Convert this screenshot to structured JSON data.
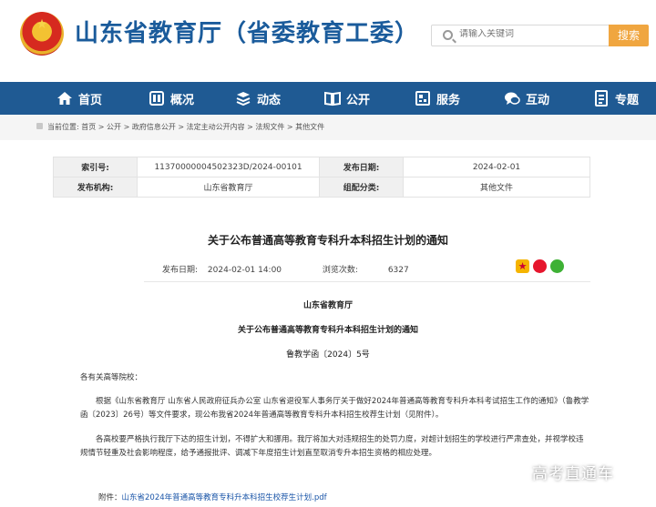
{
  "header": {
    "site_title": "山东省教育厅（省委教育工委）",
    "search_placeholder": "请输入关键词",
    "search_button": "搜索"
  },
  "nav": {
    "items": [
      {
        "label": "首页",
        "icon": "home-icon"
      },
      {
        "label": "概况",
        "icon": "overview-icon"
      },
      {
        "label": "动态",
        "icon": "news-icon"
      },
      {
        "label": "公开",
        "icon": "open-book-icon"
      },
      {
        "label": "服务",
        "icon": "service-icon"
      },
      {
        "label": "互动",
        "icon": "chat-icon"
      },
      {
        "label": "专题",
        "icon": "topic-icon"
      }
    ]
  },
  "breadcrumb": "当前位置: 首页 > 公开 > 政府信息公开 > 法定主动公开内容 > 法规文件 > 其他文件",
  "info_table": {
    "index_label": "索引号:",
    "index_value": "11370000004502323D/2024-00101",
    "date_label": "发布日期:",
    "date_value": "2024-02-01",
    "org_label": "发布机构:",
    "org_value": "山东省教育厅",
    "category_label": "组配分类:",
    "category_value": "其他文件"
  },
  "article": {
    "title": "关于公布普通高等教育专科升本科招生计划的通知",
    "publish_label": "发布日期:",
    "publish_value": "2024-02-01 14:00",
    "views_label": "浏览次数:",
    "views_value": "6327",
    "issuer": "山东省教育厅",
    "doc_title": "关于公布普通高等教育专科升本科招生计划的通知",
    "doc_number": "鲁教学函〔2024〕5号",
    "salutation": "各有关高等院校：",
    "para1": "根据《山东省教育厅 山东省人民政府征兵办公室 山东省退役军人事务厅关于做好2024年普通高等教育专科升本科考试招生工作的通知》（鲁教学函〔2023〕26号）等文件要求，现公布我省2024年普通高等教育专科升本科招生校荐生计划（见附件）。",
    "para2": "各高校要严格执行我厅下达的招生计划，不得扩大和挪用。我厅将加大对违规招生的处罚力度，对超计划招生的学校进行严肃查处，并视学校违规情节轻重及社会影响程度，给予通报批评、调减下年度招生计划直至取消专升本招生资格的相应处理。",
    "attach_label": "附件：",
    "attach_link": "山东省2024年普通高等教育专科升本科招生校荐生计划.pdf"
  },
  "watermark": "高考直通车",
  "colors": {
    "brand_blue": "#1f5a93",
    "title_blue": "#1a5b9b",
    "search_orange": "#f0a640",
    "link_blue": "#1a55a8"
  }
}
